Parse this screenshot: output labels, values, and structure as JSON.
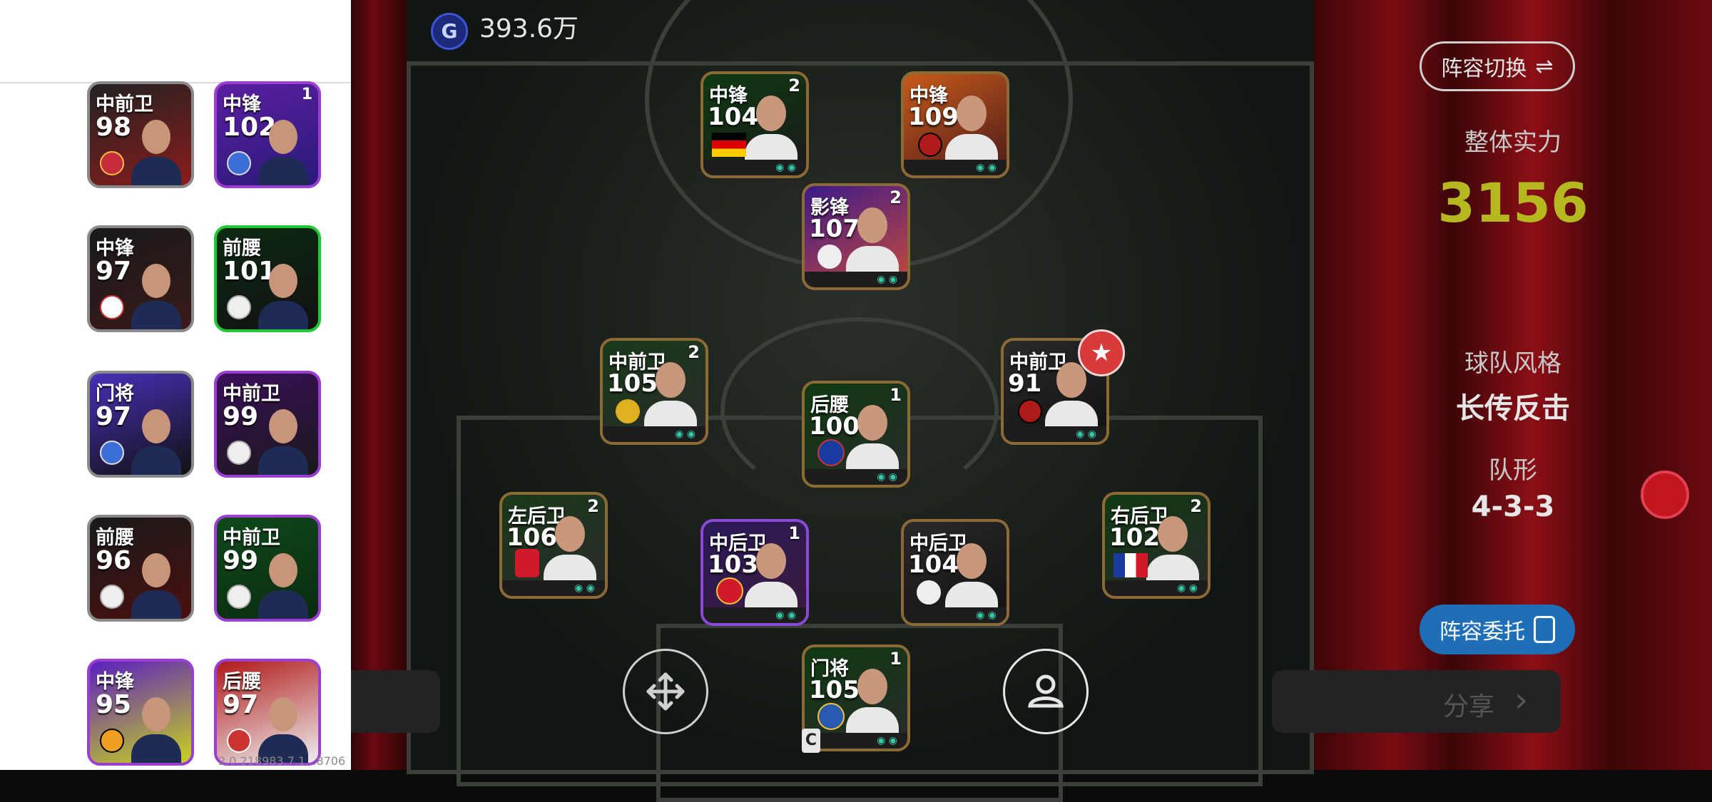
{
  "coins": {
    "icon": "G",
    "value": "393.6万"
  },
  "sidebar": {
    "cards": [
      {
        "position": "中前卫",
        "rating": "98",
        "level": ""
      },
      {
        "position": "中锋",
        "rating": "102",
        "level": "1"
      },
      {
        "position": "中锋",
        "rating": "97",
        "level": ""
      },
      {
        "position": "前腰",
        "rating": "101",
        "level": ""
      },
      {
        "position": "门将",
        "rating": "97",
        "level": ""
      },
      {
        "position": "中前卫",
        "rating": "99",
        "level": ""
      },
      {
        "position": "前腰",
        "rating": "96",
        "level": ""
      },
      {
        "position": "中前卫",
        "rating": "99",
        "level": ""
      },
      {
        "position": "中锋",
        "rating": "95",
        "level": ""
      },
      {
        "position": "后腰",
        "rating": "97",
        "level": ""
      }
    ]
  },
  "lineup": [
    {
      "position": "中锋",
      "rating": "104",
      "level": "2"
    },
    {
      "position": "中锋",
      "rating": "109",
      "level": ""
    },
    {
      "position": "影锋",
      "rating": "107",
      "level": "2"
    },
    {
      "position": "中前卫",
      "rating": "105",
      "level": "2"
    },
    {
      "position": "后腰",
      "rating": "100",
      "level": "1"
    },
    {
      "position": "中前卫",
      "rating": "91",
      "level": ""
    },
    {
      "position": "左后卫",
      "rating": "106",
      "level": "2"
    },
    {
      "position": "中后卫",
      "rating": "103",
      "level": "1"
    },
    {
      "position": "中后卫",
      "rating": "104",
      "level": ""
    },
    {
      "position": "右后卫",
      "rating": "102",
      "level": "2"
    },
    {
      "position": "门将",
      "rating": "105",
      "level": "1"
    }
  ],
  "right_panel": {
    "switch_label": "阵容切换",
    "switch_icon": "⇌",
    "strength_label": "整体实力",
    "strength_value": "3156",
    "style_label": "球队风格",
    "style_value": "长传反击",
    "formation_label": "队形",
    "formation_value": "4-3-3",
    "delegate_label": "阵容委托",
    "share_label": "分享"
  },
  "footer": {
    "version": "2.0.218983.7.1...8706",
    "c_badge": "C"
  },
  "colors": {
    "strength": "#b6b81f",
    "delegate_bg": "#1e6fb8",
    "gold_border": "#8c6a35"
  }
}
